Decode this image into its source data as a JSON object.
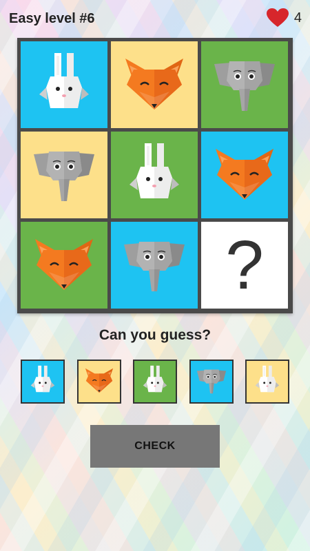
{
  "header": {
    "title": "Easy level #6",
    "lives": "4"
  },
  "colors": {
    "blue": "#1ec3f2",
    "yellow": "#fde08a",
    "green": "#6ab44a",
    "white": "#ffffff",
    "board_frame": "#4a4a4a",
    "check_button": "#777777",
    "heart": "#d7262b"
  },
  "grid": [
    [
      {
        "animal": "rabbit",
        "bg": "blue"
      },
      {
        "animal": "fox",
        "bg": "yellow"
      },
      {
        "animal": "elephant",
        "bg": "green"
      }
    ],
    [
      {
        "animal": "elephant",
        "bg": "yellow"
      },
      {
        "animal": "rabbit",
        "bg": "green"
      },
      {
        "animal": "fox",
        "bg": "blue"
      }
    ],
    [
      {
        "animal": "fox",
        "bg": "green"
      },
      {
        "animal": "elephant",
        "bg": "blue"
      },
      {
        "animal": "unknown",
        "bg": "white",
        "label": "?"
      }
    ]
  ],
  "prompt": "Can you guess?",
  "options": [
    {
      "animal": "rabbit",
      "bg": "blue"
    },
    {
      "animal": "fox",
      "bg": "yellow"
    },
    {
      "animal": "rabbit",
      "bg": "green"
    },
    {
      "animal": "elephant",
      "bg": "blue"
    },
    {
      "animal": "rabbit",
      "bg": "yellow"
    }
  ],
  "check_label": "CHECK"
}
